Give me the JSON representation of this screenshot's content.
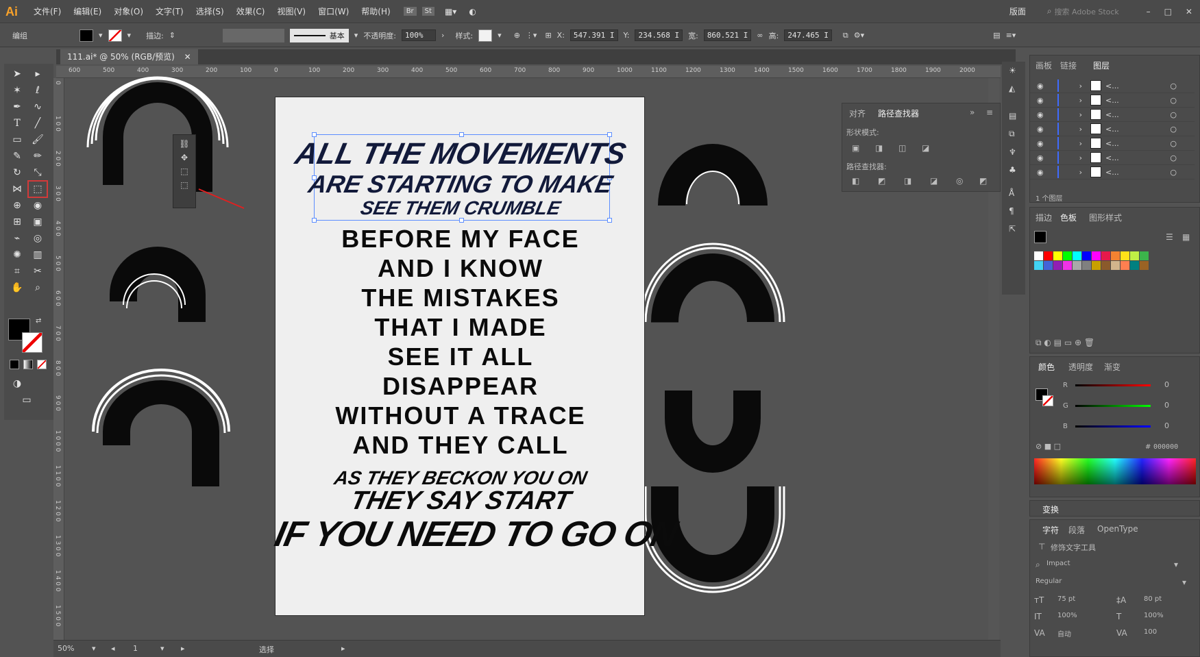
{
  "menubar": {
    "app_logo": "Ai",
    "items": [
      "文件(F)",
      "编辑(E)",
      "对象(O)",
      "文字(T)",
      "选择(S)",
      "效果(C)",
      "视图(V)",
      "窗口(W)",
      "帮助(H)"
    ],
    "br_label": "Br",
    "st_label": "St",
    "workspace_label": "版面",
    "search_placeholder": "搜索 Adobe Stock"
  },
  "controlbar": {
    "selection_type": "编组",
    "stroke_label": "描边:",
    "stroke_style": "基本",
    "opacity_label": "不透明度:",
    "opacity_value": "100%",
    "style_label": "样式:",
    "x_label": "X:",
    "x_value": "547.391 I",
    "y_label": "Y:",
    "y_value": "234.568 I",
    "w_label": "宽:",
    "w_value": "860.521 I",
    "h_label": "高:",
    "h_value": "247.465 I"
  },
  "document": {
    "tab_title": "111.ai* @ 50% (RGB/预览)",
    "ruler_h": [
      "600",
      "500",
      "400",
      "300",
      "200",
      "100",
      "0",
      "100",
      "200",
      "300",
      "400",
      "500",
      "600",
      "700",
      "800",
      "900",
      "1000",
      "1100",
      "1200",
      "1300",
      "1400",
      "1500",
      "1600",
      "1700",
      "1800",
      "1900",
      "2000"
    ],
    "ruler_v": [
      "0",
      "1 0 0",
      "2 0 0",
      "3 0 0",
      "4 0 0",
      "5 0 0",
      "6 0 0",
      "7 0 0",
      "8 0 0",
      "9 0 0",
      "1 0 0 0",
      "1 1 0 0",
      "1 2 0 0",
      "1 3 0 0",
      "1 4 0 0",
      "1 5 0 0"
    ]
  },
  "artwork": {
    "top_lines": [
      "ALL THE MOVEMENTS",
      "ARE STARTING TO MAKE",
      "SEE THEM CRUMBLE"
    ],
    "middle_lines": [
      "BEFORE MY FACE",
      "AND I KNOW",
      "THE MISTAKES",
      "THAT I MADE",
      "SEE IT ALL",
      "DISAPPEAR",
      "WITHOUT A TRACE",
      "AND THEY CALL"
    ],
    "bottom_lines": [
      "AS THEY BECKON YOU ON",
      "THEY SAY START",
      "IF YOU NEED TO GO ON"
    ]
  },
  "statusbar": {
    "zoom": "50%",
    "artboard_number": "1",
    "tool_name": "选择"
  },
  "layers_panel": {
    "tabs": [
      "画板",
      "链接",
      "图层"
    ],
    "active_tab": "图层",
    "rows": [
      "<...",
      "<...",
      "<...",
      "<...",
      "<...",
      "<...",
      "<..."
    ],
    "footer": "1 个图层"
  },
  "align_panel": {
    "tabs": [
      "对齐",
      "路径查找器"
    ],
    "shape_modes_label": "形状模式:",
    "pathfinder_label": "路径查找器:"
  },
  "swatches_panel": {
    "tabs": [
      "描边",
      "色板",
      "图形样式"
    ],
    "active_tab": "色板",
    "colors": [
      "#ffffff",
      "#ff0000",
      "#ffff00",
      "#00ff00",
      "#00ffff",
      "#0000ff",
      "#ff00ff",
      "#e6194b",
      "#f58231",
      "#ffe119",
      "#bfef45",
      "#3cb44b",
      "#42d4f4",
      "#4363d8",
      "#911eb4",
      "#f032e6",
      "#a9a9a9",
      "#808080",
      "#c8a000",
      "#8b5a2b",
      "#d2b48c",
      "#ff7f50",
      "#008080",
      "#9a6324"
    ]
  },
  "color_panel": {
    "tabs": [
      "颜色",
      "透明度",
      "渐变"
    ],
    "active_tab": "颜色",
    "r_label": "R",
    "r_value": "0",
    "g_label": "G",
    "g_value": "0",
    "b_label": "B",
    "b_value": "0",
    "hex_label": "#",
    "hex_value": "000000"
  },
  "transform_panel": {
    "title": "变换"
  },
  "character_panel": {
    "tabs": [
      "字符",
      "段落",
      "OpenType"
    ],
    "active_tab": "字符",
    "touch_tool": "修饰文字工具",
    "font_family": "Impact",
    "font_style": "Regular",
    "font_size": "75 pt",
    "leading": "80 pt",
    "vertical_scale": "100%",
    "horizontal_scale": "100%",
    "kerning": "自动",
    "tracking": "100"
  }
}
